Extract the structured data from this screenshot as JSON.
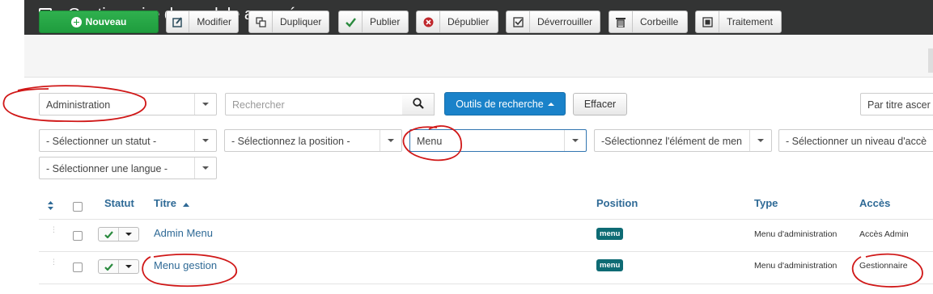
{
  "header": {
    "title": "Gestionnaire de module avancé"
  },
  "toolbar": {
    "new": "Nouveau",
    "edit": "Modifier",
    "duplicate": "Dupliquer",
    "publish": "Publier",
    "unpublish": "Dépublier",
    "unlock": "Déverrouiller",
    "trash": "Corbeille",
    "batch": "Traitement"
  },
  "filters": {
    "client": "Administration",
    "search_placeholder": "Rechercher",
    "search_tools": "Outils de recherche",
    "clear": "Effacer",
    "ordering": "Par titre ascer",
    "status": "- Sélectionner un statut -",
    "position": "- Sélectionnez la position -",
    "module_type": "Menu",
    "menu_item": "-Sélectionnez l'élément de men",
    "access": "- Sélectionner un niveau d'accè",
    "language": "- Sélectionner une langue -"
  },
  "table": {
    "headers": {
      "status": "Statut",
      "title": "Titre",
      "position": "Position",
      "type": "Type",
      "access": "Accès"
    },
    "rows": [
      {
        "title": "Admin Menu",
        "position": "menu",
        "type": "Menu d'administration",
        "access": "Accès Admin"
      },
      {
        "title": "Menu gestion",
        "position": "menu",
        "type": "Menu d'administration",
        "access": "Gestionnaire"
      }
    ]
  },
  "colors": {
    "header_bg": "#333434",
    "new_green": "#22a340",
    "primary_blue": "#1a82c9",
    "badge_teal": "#0e6b74",
    "annotation_red": "#d01818"
  }
}
